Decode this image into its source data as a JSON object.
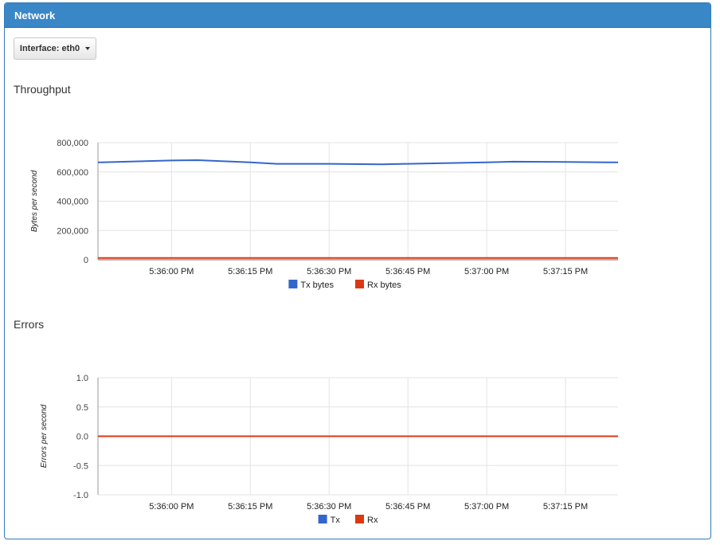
{
  "panel": {
    "title": "Network"
  },
  "interface_button": {
    "label": "Interface: eth0"
  },
  "sections": {
    "throughput_title": "Throughput",
    "errors_title": "Errors"
  },
  "colors": {
    "header": "#3a87c8",
    "tx": "#3366cc",
    "rx": "#dc3912",
    "grid": "#e3e3e3",
    "axis": "#444444"
  },
  "chart_data": [
    {
      "type": "line",
      "name": "throughput",
      "ylabel": "Bytes per second",
      "xlabel": "",
      "ylim": [
        0,
        800000
      ],
      "yticks": [
        "800,000",
        "600,000",
        "400,000",
        "200,000",
        "0"
      ],
      "ytick_values": [
        800000,
        600000,
        400000,
        200000,
        0
      ],
      "xtick_labels": [
        "5:36:00 PM",
        "5:36:15 PM",
        "5:36:30 PM",
        "5:36:45 PM",
        "5:37:00 PM",
        "5:37:15 PM"
      ],
      "grid": true,
      "legend_position": "bottom",
      "series": [
        {
          "name": "Tx bytes",
          "color": "#3366cc",
          "x": [
            "5:35:46 PM",
            "5:36:00 PM",
            "5:36:05 PM",
            "5:36:15 PM",
            "5:36:20 PM",
            "5:36:30 PM",
            "5:36:40 PM",
            "5:36:45 PM",
            "5:37:00 PM",
            "5:37:05 PM",
            "5:37:15 PM",
            "5:37:25 PM"
          ],
          "values": [
            665000,
            678000,
            680000,
            665000,
            655000,
            655000,
            652000,
            655000,
            665000,
            670000,
            668000,
            665000
          ]
        },
        {
          "name": "Rx bytes",
          "color": "#dc3912",
          "x": [
            "5:35:46 PM",
            "5:37:25 PM"
          ],
          "values": [
            12000,
            12000
          ]
        }
      ]
    },
    {
      "type": "line",
      "name": "errors",
      "ylabel": "Errors per second",
      "xlabel": "",
      "ylim": [
        -1.0,
        1.0
      ],
      "yticks": [
        "1.0",
        "0.5",
        "0.0",
        "-0.5",
        "-1.0"
      ],
      "ytick_values": [
        1.0,
        0.5,
        0.0,
        -0.5,
        -1.0
      ],
      "xtick_labels": [
        "5:36:00 PM",
        "5:36:15 PM",
        "5:36:30 PM",
        "5:36:45 PM",
        "5:37:00 PM",
        "5:37:15 PM"
      ],
      "grid": true,
      "legend_position": "bottom",
      "series": [
        {
          "name": "Tx",
          "color": "#3366cc",
          "x": [
            "5:35:46 PM",
            "5:37:25 PM"
          ],
          "values": [
            0,
            0
          ]
        },
        {
          "name": "Rx",
          "color": "#dc3912",
          "x": [
            "5:35:46 PM",
            "5:37:25 PM"
          ],
          "values": [
            0,
            0
          ]
        }
      ]
    }
  ]
}
